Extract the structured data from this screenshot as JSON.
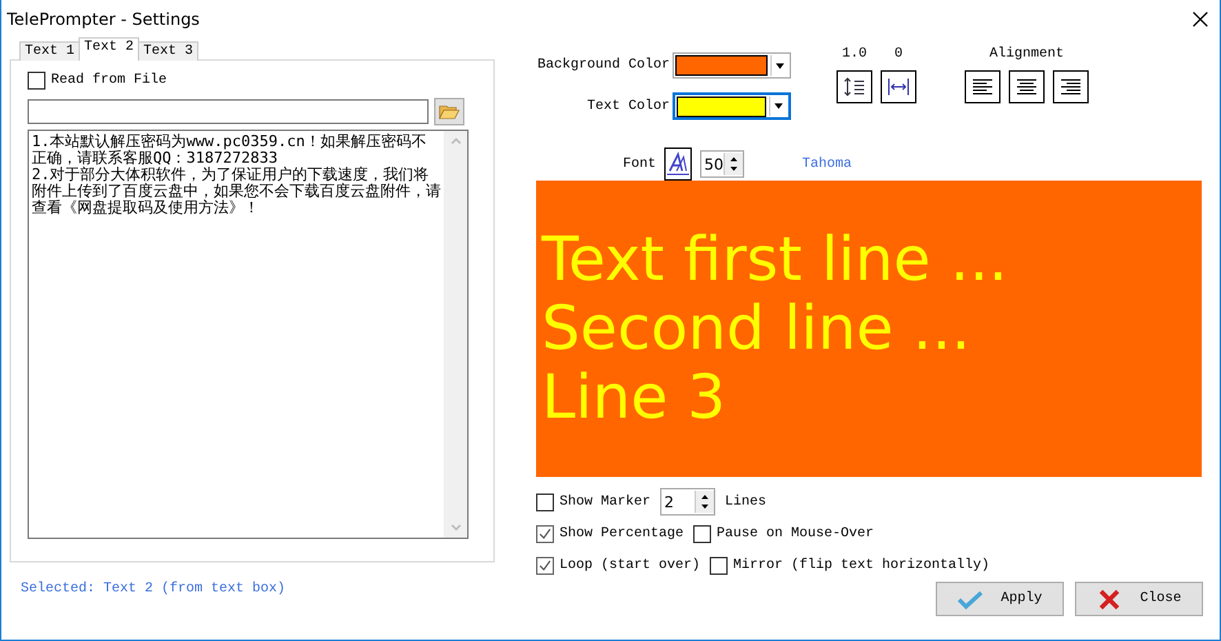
{
  "window": {
    "title": "TelePrompter - Settings"
  },
  "tabs": [
    {
      "label": "Text 1",
      "selected": false
    },
    {
      "label": "Text 2",
      "selected": true
    },
    {
      "label": "Text 3",
      "selected": false
    }
  ],
  "text_panel": {
    "read_from_file": {
      "label": "Read from File",
      "checked": false
    },
    "text": [
      "1.本站默认解压密码为www.pc0359.cn！如果解压密码不正确，请联系客服QQ：3187272833",
      "2.对于部分大体积软件，为了保证用户的下载速度，我们将附件上传到了百度云盘中，如果您不会下载百度云盘附件，请查看《网盘提取码及使用方法》！"
    ]
  },
  "status": "Selected: Text 2 (from text box)",
  "colors": [
    {
      "label": "Background Color",
      "color": "#ff6600",
      "focused": false
    },
    {
      "label": "Text Color",
      "color": "#ffff00",
      "focused": true
    }
  ],
  "spacing": [
    {
      "kind": "line",
      "value": "1.0"
    },
    {
      "kind": "char",
      "value": "0"
    }
  ],
  "alignment": {
    "label": "Alignment",
    "buttons": [
      {
        "kind": "left"
      },
      {
        "kind": "center"
      },
      {
        "kind": "right"
      }
    ]
  },
  "font": {
    "label": "Font",
    "size": "50",
    "name": "Tahoma"
  },
  "preview": {
    "lines": [
      "Text first line ...",
      "Second line ...",
      "Line 3"
    ]
  },
  "options": [
    [
      {
        "kind": "checkbox",
        "label": "Show Marker",
        "checked": false
      },
      {
        "kind": "spinner",
        "value": "2"
      },
      {
        "kind": "text",
        "label": "Lines"
      }
    ],
    [
      {
        "kind": "checkbox",
        "label": "Show Percentage",
        "checked": true
      },
      {
        "kind": "checkbox",
        "label": "Pause on Mouse-Over",
        "checked": false
      }
    ],
    [
      {
        "kind": "checkbox",
        "label": "Loop (start over)",
        "checked": true
      },
      {
        "kind": "checkbox",
        "label": "Mirror (flip text horizontally)",
        "checked": false
      }
    ]
  ],
  "buttons": [
    {
      "kind": "apply",
      "label": "Apply"
    },
    {
      "kind": "close",
      "label": "Close"
    }
  ]
}
